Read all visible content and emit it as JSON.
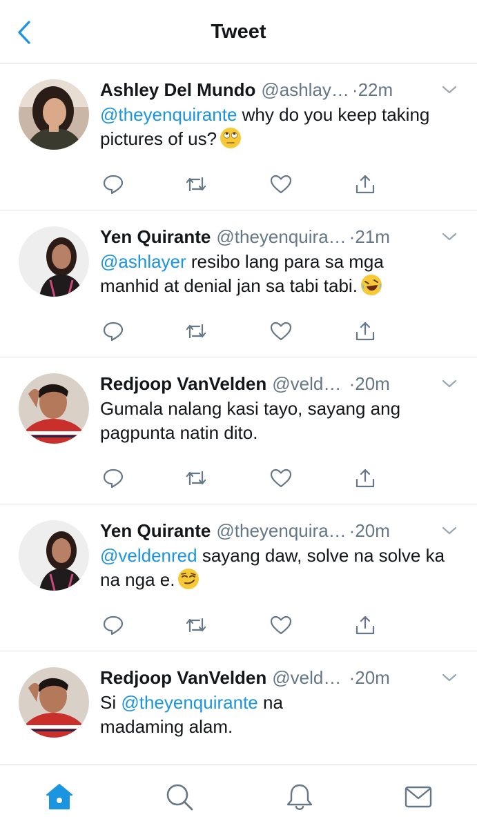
{
  "header": {
    "title": "Tweet",
    "back_icon": "chevron-left-icon"
  },
  "colors": {
    "accent": "#1b95e0",
    "text": "#14171a",
    "secondary": "#657786",
    "divider": "#dfe3e7"
  },
  "tweets": [
    {
      "name": "Ashley Del Mundo",
      "handle": "@ashlay…",
      "time": "22m",
      "mention": "@theyenquirante",
      "text": " why do you keep taking pictures of us?",
      "emoji": "face-with-rolling-eyes"
    },
    {
      "name": "Yen Quirante",
      "handle": "@theyenquira…",
      "time": "21m",
      "mention": "@ashlayer",
      "text": " resibo lang para sa mga manhid at denial jan sa tabi tabi.",
      "emoji": "rolling-on-the-floor-laughing"
    },
    {
      "name": "Redjoop VanVelden",
      "handle": "@veld…",
      "time": "20m",
      "mention": "",
      "text": "Gumala nalang kasi tayo, sayang ang pagpunta natin dito.",
      "emoji": ""
    },
    {
      "name": "Yen Quirante",
      "handle": "@theyenquira…",
      "time": "20m",
      "mention": "@veldenred",
      "text": " sayang daw, solve na solve ka na nga e.",
      "emoji": "smirking-face"
    },
    {
      "name": "Redjoop VanVelden",
      "handle": "@veld…",
      "time": "20m",
      "text_before": "Si ",
      "mention": "@theyenquirante",
      "text": " na madaming alam.",
      "emoji": ""
    }
  ],
  "actions": [
    "reply-icon",
    "retweet-icon",
    "like-icon",
    "share-icon"
  ],
  "tabbar": [
    "home-icon",
    "search-icon",
    "notifications-icon",
    "messages-icon"
  ]
}
